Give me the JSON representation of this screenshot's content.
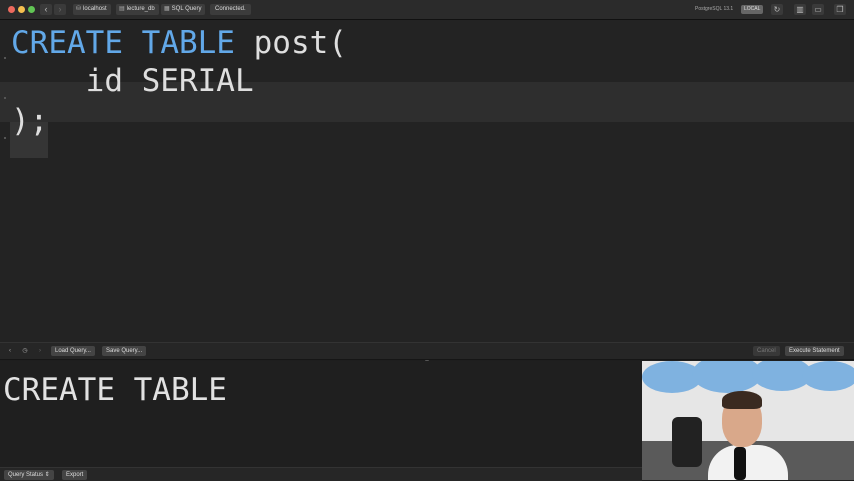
{
  "titlebar": {
    "breadcrumbs": [
      {
        "icon": "server-icon",
        "label": "localhost"
      },
      {
        "icon": "database-icon",
        "label": "lecture_db"
      },
      {
        "icon": "query-icon",
        "label": "SQL Query"
      }
    ],
    "status": "Connected.",
    "server_version": "PostgreSQL 13.1",
    "server_badge": "LOCAL"
  },
  "editor": {
    "line1_kw1": "CREATE",
    "line1_kw2": "TABLE",
    "line1_rest": " post(",
    "line2": "    id SERIAL",
    "line3": ");"
  },
  "midbar": {
    "load_query": "Load Query...",
    "save_query": "Save Query...",
    "cancel": "Cancel",
    "execute": "Execute Statement"
  },
  "results": {
    "text": "CREATE TABLE"
  },
  "bottombar": {
    "query_status": "Query Status",
    "export": "Export"
  },
  "colors": {
    "keyword": "#62a8e8",
    "background": "#232323"
  }
}
